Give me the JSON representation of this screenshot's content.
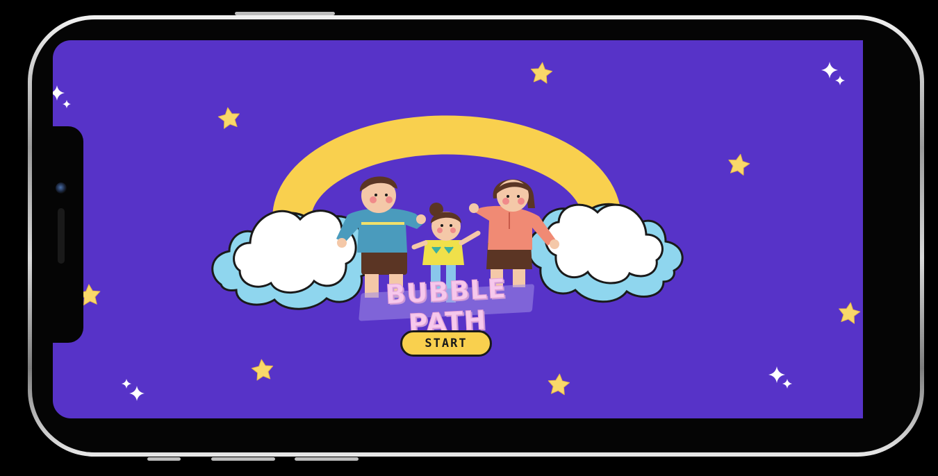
{
  "game": {
    "title": "BUBBLE PATH",
    "start_label": "START"
  },
  "colors": {
    "background": "#5733c8",
    "star": "#f9d86a",
    "rainbow": "#f9d04e",
    "cloud_fill": "#ffffff",
    "cloud_shadow": "#8fd6ee",
    "title": "#f6c8ec",
    "button": "#f9d04e"
  },
  "decorations": {
    "stars": "star-icon",
    "sparkles": "sparkle-icon"
  }
}
